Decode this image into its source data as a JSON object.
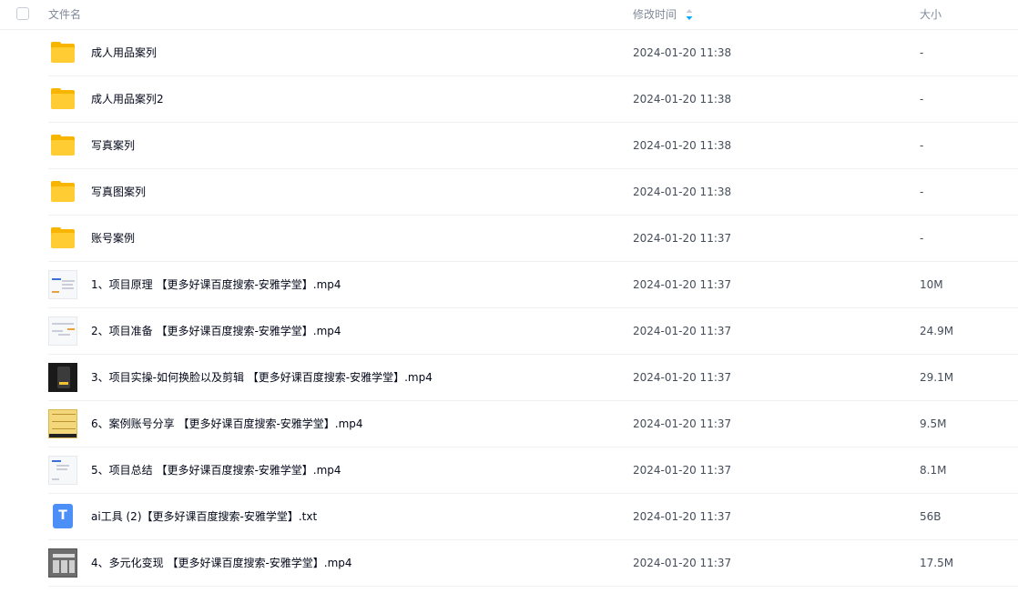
{
  "header": {
    "name_label": "文件名",
    "time_label": "修改时间",
    "size_label": "大小"
  },
  "files": [
    {
      "name": "成人用品案列",
      "time": "2024-01-20 11:38",
      "size": "-",
      "icon": "folder-icon"
    },
    {
      "name": "成人用品案列2",
      "time": "2024-01-20 11:38",
      "size": "-",
      "icon": "folder-icon"
    },
    {
      "name": "写真案列",
      "time": "2024-01-20 11:38",
      "size": "-",
      "icon": "folder-icon"
    },
    {
      "name": "写真图案列",
      "time": "2024-01-20 11:38",
      "size": "-",
      "icon": "folder-icon"
    },
    {
      "name": "账号案例",
      "time": "2024-01-20 11:37",
      "size": "-",
      "icon": "folder-icon"
    },
    {
      "name": "1、项目原理 【更多好课百度搜索-安雅学堂】.mp4",
      "time": "2024-01-20 11:37",
      "size": "10M",
      "icon": "video-thumbnail-icon"
    },
    {
      "name": "2、项目准备 【更多好课百度搜索-安雅学堂】.mp4",
      "time": "2024-01-20 11:37",
      "size": "24.9M",
      "icon": "video-thumbnail-icon"
    },
    {
      "name": "3、项目实操-如何换脸以及剪辑 【更多好课百度搜索-安雅学堂】.mp4",
      "time": "2024-01-20 11:37",
      "size": "29.1M",
      "icon": "video-thumbnail-icon"
    },
    {
      "name": "6、案例账号分享 【更多好课百度搜索-安雅学堂】.mp4",
      "time": "2024-01-20 11:37",
      "size": "9.5M",
      "icon": "video-thumbnail-icon"
    },
    {
      "name": "5、项目总结 【更多好课百度搜索-安雅学堂】.mp4",
      "time": "2024-01-20 11:37",
      "size": "8.1M",
      "icon": "video-thumbnail-icon"
    },
    {
      "name": "ai工具 (2)【更多好课百度搜索-安雅学堂】.txt",
      "time": "2024-01-20 11:37",
      "size": "56B",
      "icon": "txt-file-icon",
      "icon_letter": "T"
    },
    {
      "name": "4、多元化变现 【更多好课百度搜索-安雅学堂】.mp4",
      "time": "2024-01-20 11:37",
      "size": "17.5M",
      "icon": "video-thumbnail-icon"
    }
  ],
  "colors": {
    "folder": "#ffcc33",
    "txt_icon": "#4b8ff7",
    "sort_arrow": "#06a7ff"
  }
}
